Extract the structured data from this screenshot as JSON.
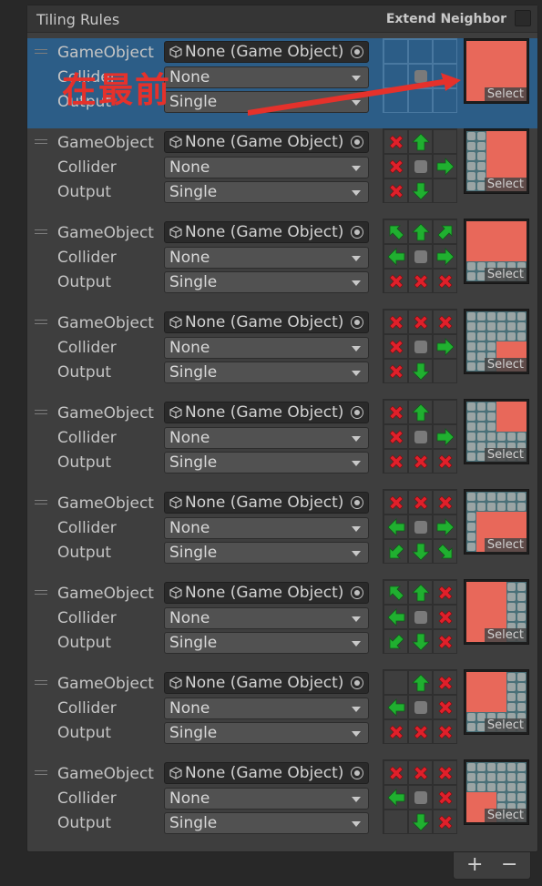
{
  "panel": {
    "title": "Tiling Rules",
    "extend_neighbor_label": "Extend Neighbor",
    "extend_neighbor_checked": false
  },
  "labels": {
    "gameobject": "GameObject",
    "collider": "Collider",
    "output": "Output",
    "select": "Select"
  },
  "annotation": {
    "text": "在最前",
    "color": "#e5312b"
  },
  "colors": {
    "selected_row": "#2c5d87",
    "arrow_green": "#20b030",
    "cross_red": "#e0202a",
    "tile_red": "#e8685a",
    "tile_stone": "#9aa4a4"
  },
  "rules": [
    {
      "gameobject": "None (Game Object)",
      "collider": "None",
      "output": "Single",
      "selected": true,
      "neighbors": [
        "",
        "",
        "",
        "",
        "",
        "",
        "",
        "",
        ""
      ],
      "preview": "full"
    },
    {
      "gameobject": "None (Game Object)",
      "collider": "None",
      "output": "Single",
      "selected": false,
      "neighbors": [
        "x",
        "up",
        "",
        "x",
        "",
        "right",
        "x",
        "down",
        ""
      ],
      "preview": "left-edge"
    },
    {
      "gameobject": "None (Game Object)",
      "collider": "None",
      "output": "Single",
      "selected": false,
      "neighbors": [
        "up-left",
        "up",
        "up-right",
        "left",
        "",
        "right",
        "x",
        "x",
        "x"
      ],
      "preview": "bottom-edge"
    },
    {
      "gameobject": "None (Game Object)",
      "collider": "None",
      "output": "Single",
      "selected": false,
      "neighbors": [
        "x",
        "x",
        "x",
        "x",
        "",
        "right",
        "x",
        "down",
        ""
      ],
      "preview": "inner-bottom-right"
    },
    {
      "gameobject": "None (Game Object)",
      "collider": "None",
      "output": "Single",
      "selected": false,
      "neighbors": [
        "x",
        "up",
        "",
        "x",
        "",
        "right",
        "x",
        "x",
        "x"
      ],
      "preview": "inner-top-right"
    },
    {
      "gameobject": "None (Game Object)",
      "collider": "None",
      "output": "Single",
      "selected": false,
      "neighbors": [
        "x",
        "x",
        "x",
        "left",
        "",
        "right",
        "down-left",
        "down",
        "down-right"
      ],
      "preview": "top-edge"
    },
    {
      "gameobject": "None (Game Object)",
      "collider": "None",
      "output": "Single",
      "selected": false,
      "neighbors": [
        "up-left",
        "up",
        "x",
        "left",
        "",
        "x",
        "down-left",
        "down",
        "x"
      ],
      "preview": "right-edge"
    },
    {
      "gameobject": "None (Game Object)",
      "collider": "None",
      "output": "Single",
      "selected": false,
      "neighbors": [
        "",
        "up",
        "x",
        "left",
        "",
        "x",
        "x",
        "x",
        "x"
      ],
      "preview": "inner-top-left"
    },
    {
      "gameobject": "None (Game Object)",
      "collider": "None",
      "output": "Single",
      "selected": false,
      "neighbors": [
        "x",
        "x",
        "x",
        "left",
        "",
        "x",
        "",
        "down",
        "x"
      ],
      "preview": "inner-bottom-left"
    }
  ],
  "footer": {
    "add_label": "+",
    "remove_label": "−"
  }
}
